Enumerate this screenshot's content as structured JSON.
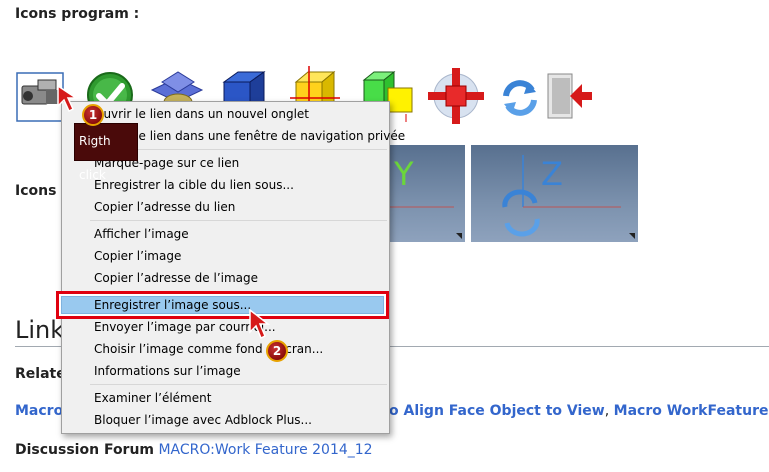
{
  "page": {
    "icons_program_label": "Icons program :",
    "icons_label_partial": "Icons",
    "links_heading": "Link",
    "related_label": "Relate",
    "macro_line": {
      "left_link": "Macro",
      "right_link_1": "o Align Face Object to View",
      "separator": ",",
      "right_link_2": "Macro WorkFeatures"
    },
    "discussion": {
      "label": "Discussion Forum",
      "link": "MACRO:Work Feature 2014_12"
    }
  },
  "thumbs": {
    "y_label": "Y",
    "z_label": "Z"
  },
  "context_menu": {
    "items_group1": [
      "Ouvrir le lien dans un nouvel onglet",
      "Ouvrir le lien dans une fenêtre de navigation privée"
    ],
    "items_group2": [
      "Marque-page sur ce lien",
      "Enregistrer la cible du lien sous...",
      "Copier l’adresse du lien"
    ],
    "items_group3": [
      "Afficher l’image",
      "Copier l’image",
      "Copier l’adresse de l’image",
      "Enregistrer l’image sous...",
      "Envoyer l’image par courriel...",
      "Choisir l’image comme fond d’écran...",
      "Informations sur l’image"
    ],
    "items_group4": [
      "Examiner l’élément",
      "Bloquer l’image avec Adblock Plus..."
    ],
    "highlighted_index": 3
  },
  "annotations": {
    "step1_number": "1",
    "step1_text": "Rigth click",
    "step2_number": "2"
  },
  "colors": {
    "highlight_fill": "#99c9ef",
    "highlight_border": "#e0000f",
    "link": "#3366cc"
  },
  "icons": [
    "camera-icon",
    "checkmark-icon",
    "stack-icon",
    "cube-icon",
    "yellow-cube-icon",
    "green-cube-icon",
    "red-cross-icon",
    "refresh-icon",
    "exit-icon"
  ]
}
